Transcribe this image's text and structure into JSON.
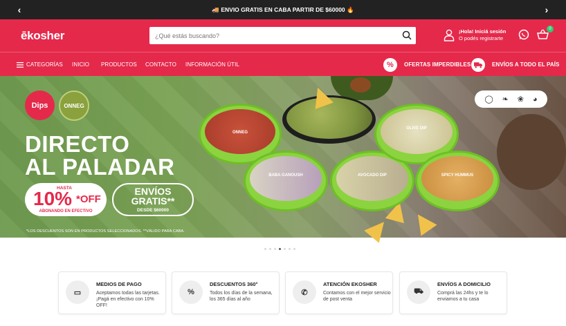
{
  "topbar": {
    "message": "🚚 ENVIO GRATIS EN CABA PARTIR DE $60000 🔥",
    "prev_icon": "chevron-left-icon",
    "next_icon": "chevron-right-icon"
  },
  "header": {
    "logo": "ēkosher",
    "search_placeholder": "¿Qué estás buscando?",
    "user_line1": "¡Hola! Iniciá sesión",
    "user_line2": "O podés registrarte",
    "cart_count": "0"
  },
  "nav": {
    "categorias": "CATEGORÍAS",
    "inicio": "INICIO",
    "productos": "PRODUCTOS",
    "contacto": "CONTACTO",
    "info": "INFORMACIÓN ÚTIL",
    "ofertas": "OFERTAS IMPERDIBLES",
    "envios": "ENVÍOS A TODO EL PAÍS",
    "ofertas_icon": "%"
  },
  "hero": {
    "dips": "Dips",
    "onneg": "ONNEG",
    "headline1": "DIRECTO",
    "headline2": "AL PALADAR",
    "hasta": "HASTA",
    "pct": "10%",
    "off": "*OFF",
    "abonando": "ABONANDO EN EFECTIVO",
    "envios1": "ENVÍOS",
    "envios2": "GRATIS**",
    "desde": "DESDE $60000",
    "disclaimer": "*LOS DESCUENTOS SON EN PRODUCTOS SELECCIONADOS. **VÁLIDO PARA CABA.",
    "tub_labels": [
      "ONNEG",
      "BABA GANOUSH",
      "AVOCADO DIP",
      "OLIVE DIP",
      "SPICY HUMMUS"
    ]
  },
  "features": [
    {
      "title": "MEDIOS DE PAGO",
      "desc": "Aceptamos todas las tarjetas. ¡Pagá en efectivo con 10% OFF!",
      "icon": "▭"
    },
    {
      "title": "DESCUENTOS 360°",
      "desc": "Todos los días de la semana, los 365 días al año",
      "icon": "%"
    },
    {
      "title": "ATENCIÓN EKOSHER",
      "desc": "Contamos con el mejor servicio de post venta",
      "icon": "✆"
    },
    {
      "title": "ENVÍOS A DOMICILIO",
      "desc": "Comprá las 24hs y te lo enviamos a tu casa",
      "icon": "⛟"
    }
  ],
  "colors": {
    "brand": "#e5294b",
    "topbar": "#222222",
    "accent_green": "#8cd340"
  }
}
